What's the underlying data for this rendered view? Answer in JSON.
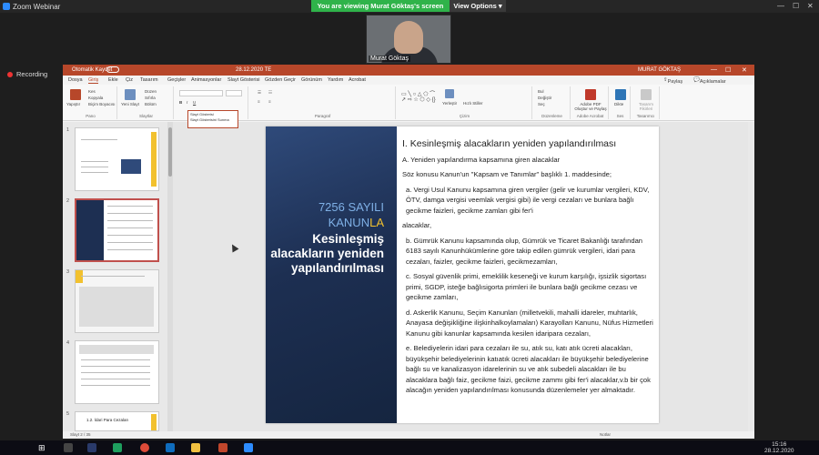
{
  "zoom": {
    "window_title": "Zoom Webinar",
    "viewing_banner": "You are viewing Murat Göktaş's screen",
    "view_options": "View Options",
    "video_name": "Murat Göktaş",
    "recording": "Recording"
  },
  "ppt": {
    "autosave": "Otomatik Kaydet",
    "filename": "28.12.2020 TE",
    "user": "MURAT GÖKTAŞ",
    "menu": [
      "Dosya",
      "Giriş",
      "Ekle",
      "Çiz",
      "Tasarım",
      "Geçişler",
      "Animasyonlar",
      "Slayt Gösterisi",
      "Gözden Geçir",
      "Görünüm",
      "Yardım",
      "Acrobat"
    ],
    "share": "Paylaş",
    "comments": "Açıklamalar",
    "ribbon_groups": [
      "Pano",
      "Slaytlar",
      "Paragraf",
      "Çizim",
      "Düzenleme",
      "Adobe Acrobat",
      "Ses",
      "Tasarımcı"
    ],
    "paste": "Yapıştır",
    "new_slide": "Yeni Slayt",
    "layout": "Düzen",
    "reset": "Sıfırla",
    "section": "Bölüm",
    "cut": "Kes",
    "copy": "Kopyala",
    "format_painter": "Biçim Boyacısı",
    "arrange": "Yerleştir",
    "quick_styles": "Hızlı Stiller",
    "find": "Bul",
    "replace": "Değiştir",
    "select": "Seç",
    "adobe": "Adobe PDF Oluştur ve Paylaş",
    "dictate": "Dikte",
    "design_ideas": "Tasarım Fikirleri",
    "tooltip_line1": "Slayt Gösterisi",
    "tooltip_line2": "Slayt Gösterisini Sunma",
    "thumb_nums": [
      "1",
      "2",
      "3",
      "4",
      "5"
    ],
    "thumb5_title": "1.2. İdari Para Cezaları",
    "status_left": "Slayt 2 / 35",
    "status_right": "Notlar"
  },
  "slide": {
    "left_line1": "7256 SAYILI",
    "left_line2": "KANUN",
    "left_line2b": "LA",
    "left_title": "Kesinleşmiş alacakların yeniden yapılandırılması",
    "heading": "I. Kesinleşmiş alacakların yeniden yapılandırılması",
    "sub": "A. Yeniden yapılandırma kapsamına giren alacaklar",
    "intro": "Söz konusu Kanun'un \"Kapsam ve Tanımlar\" başlıklı 1. maddesinde;",
    "a": "a. Vergi Usul Kanunu kapsamına giren vergiler (gelir ve kurumlar vergileri, KDV, ÖTV, damga vergisi veemlak vergisi gibi) ile vergi cezaları ve bunlara bağlı gecikme faizleri, gecikme zamları gibi fer'i",
    "a2": "alacaklar,",
    "b": "b. Gümrük Kanunu kapsamında olup, Gümrük ve Ticaret Bakanlığı tarafından 6183 sayılı Kanunhükümlerine göre takip edilen gümrük vergileri, idari para cezaları, faizler, gecikme faizleri, gecikmezamları,",
    "c": "c. Sosyal güvenlik primi, emeklilik keseneği ve kurum karşılığı, işsizlik sigortası primi, SGDP, isteğe bağlısigorta primleri ile bunlara bağlı gecikme cezası ve gecikme zamları,",
    "d": "d. Askerlik Kanunu, Seçim Kanunları (milletvekili, mahalli idareler, muhtarlık, Anayasa değişikliğine ilişkinhalkoylamaları) Karayolları Kanunu, Nüfus Hizmetleri Kanunu gibi kanunlar kapsamında kesilen idaripara cezaları,",
    "e": "e. Belediyelerin idari para cezaları ile su, atık su, katı atık ücreti alacakları, büyükşehir belediyelerinin katıatık ücreti alacakları ile büyükşehir belediyelerine bağlı su ve kanalizasyon idarelerinin su ve atık subedeli alacakları ile bu alacaklara bağlı faiz, gecikme faizi, gecikme zammı gibi fer'i alacaklar,v.b bir çok alacağın yeniden yapılandırılması konusunda düzenlemeler yer almaktadır."
  },
  "taskbar": {
    "time": "15:16",
    "date": "28.12.2020"
  }
}
